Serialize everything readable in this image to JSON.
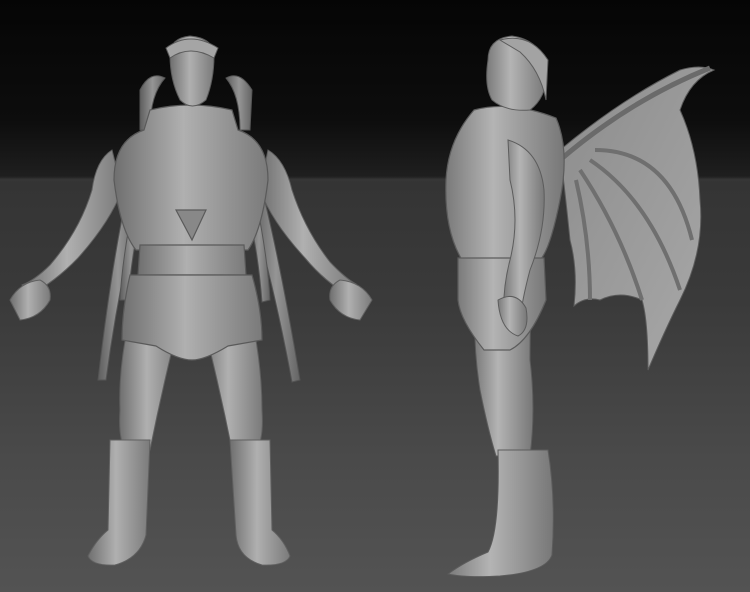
{
  "scene": {
    "subject": "",
    "background_top_color": "#050505",
    "background_floor_color": "#4a4a4a",
    "clay_color": "#9a9a9a"
  },
  "views": []
}
